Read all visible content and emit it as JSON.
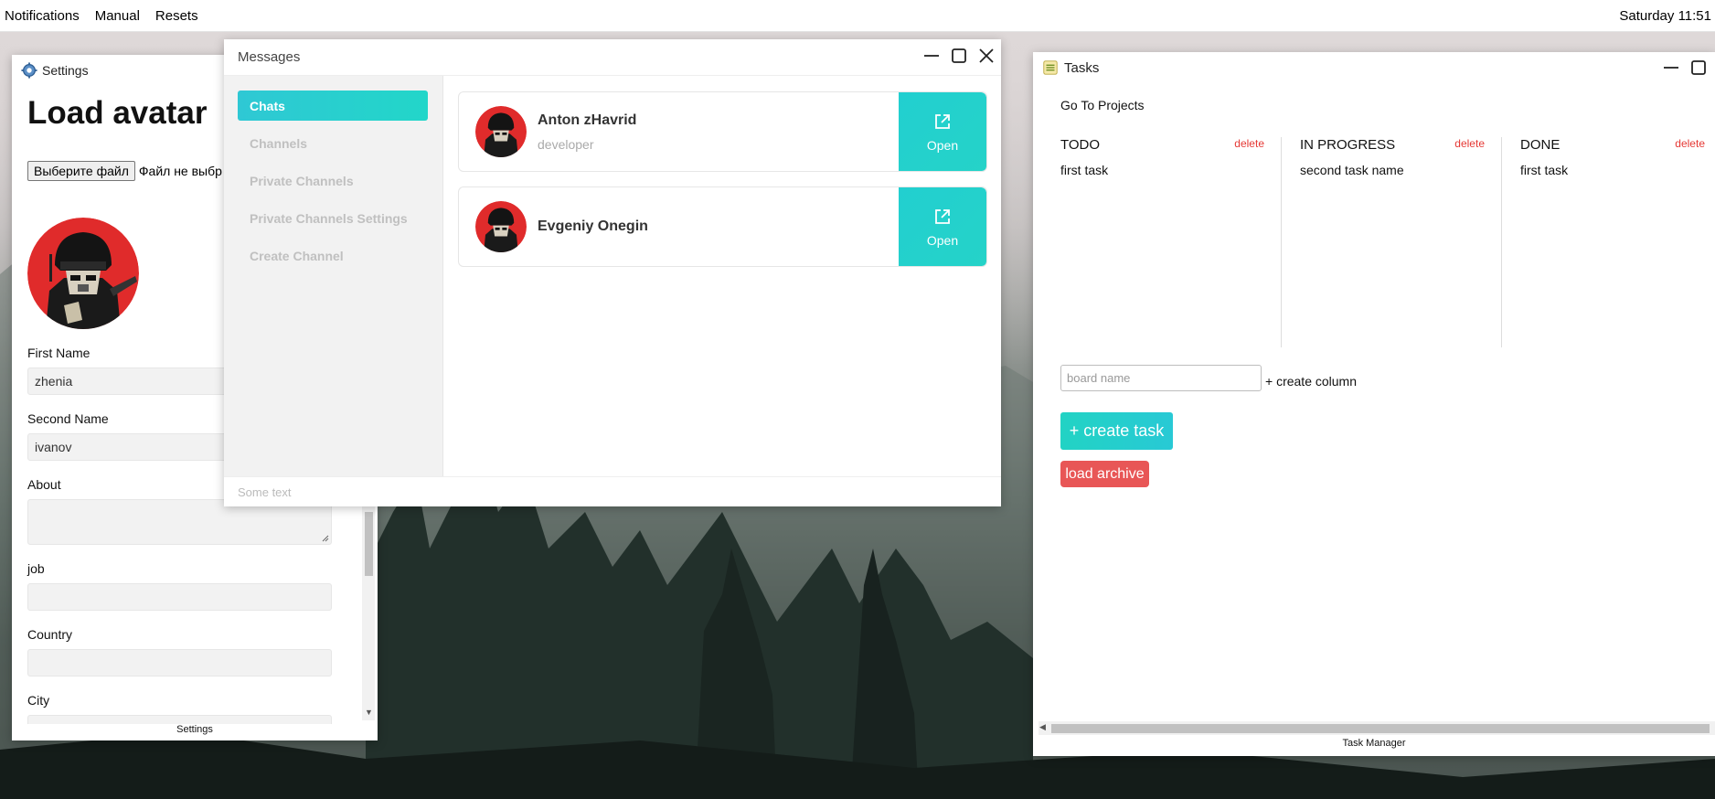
{
  "menubar": {
    "items": [
      "Notifications",
      "Manual",
      "Resets"
    ],
    "clock": "Saturday 11:51"
  },
  "settings": {
    "title": "Settings",
    "heading": "Load avatar",
    "file_button": "Выберите файл",
    "file_status": "Файл не выбр",
    "fields": {
      "first_name_label": "First Name",
      "first_name_value": "zhenia",
      "second_name_label": "Second Name",
      "second_name_value": "ivanov",
      "about_label": "About",
      "job_label": "job",
      "country_label": "Country",
      "city_label": "City"
    },
    "footer": "Settings"
  },
  "messages": {
    "title": "Messages",
    "nav": [
      "Chats",
      "Channels",
      "Private Channels",
      "Private Channels Settings",
      "Create Channel"
    ],
    "active_nav": "Chats",
    "chats": [
      {
        "name": "Anton zHavrid",
        "role": "developer",
        "action": "Open"
      },
      {
        "name": "Evgeniy Onegin",
        "role": "",
        "action": "Open"
      }
    ],
    "input_placeholder": "Some text"
  },
  "tasks": {
    "title": "Tasks",
    "go_to_projects": "Go To Projects",
    "delete_label": "delete",
    "columns": [
      {
        "name": "TODO",
        "tasks": [
          "first task"
        ]
      },
      {
        "name": "IN PROGRESS",
        "tasks": [
          "second task name"
        ]
      },
      {
        "name": "DONE",
        "tasks": [
          "first task"
        ]
      }
    ],
    "board_placeholder": "board name",
    "create_column": "+ create column",
    "create_task": "+ create task",
    "load_archive": "load archive",
    "footer": "Task Manager"
  },
  "colors": {
    "accent_teal": "#22d3c4",
    "danger_red": "#e85656",
    "delete_red": "#e53935"
  }
}
